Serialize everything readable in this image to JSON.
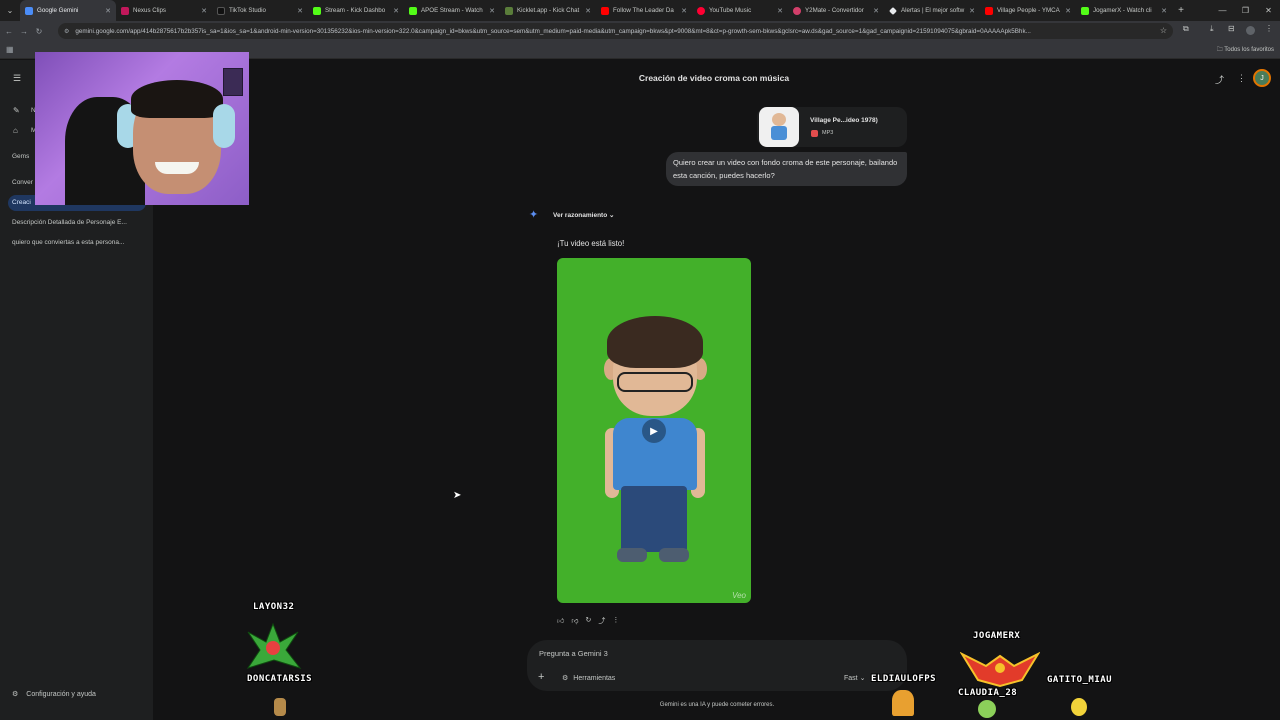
{
  "browser": {
    "tabs": [
      {
        "title": "Google Gemini",
        "color": "#4b8df8"
      },
      {
        "title": "Nexus Clips",
        "color": "#c2185b"
      },
      {
        "title": "TikTok Studio",
        "color": "#111111"
      },
      {
        "title": "Stream - Kick Dashbo",
        "color": "#53fc18"
      },
      {
        "title": "APOE Stream - Watch",
        "color": "#53fc18"
      },
      {
        "title": "Kicklet.app - Kick Chat",
        "color": "#5a7d3a"
      },
      {
        "title": "Follow The Leader Da",
        "color": "#ff0000"
      },
      {
        "title": "YouTube Music",
        "color": "#ff0033"
      },
      {
        "title": "Y2Mate - Convertidor",
        "color": "#d23f6a"
      },
      {
        "title": "Alertas | El mejor softw",
        "color": "#e8eaed"
      },
      {
        "title": "Village People - YMCA",
        "color": "#ff0000"
      },
      {
        "title": "JogamerX - Watch cli",
        "color": "#53fc18"
      }
    ],
    "url": "gemini.google.com/app/414b2875617b2b357is_sa=1&ios_sa=1&android-min-version=301356232&ios-min-version=322.0&campaign_id=bkws&utm_source=sem&utm_medium=paid-media&utm_campaign=bkws&pt=9008&mt=8&ct=p-growth-sem-bkws&gclsrc=aw.ds&gad_source=1&gad_campaignid=21591094075&gbraid=0AAAAApk5Bhk...",
    "bookmarks_label": "Todos los favoritos"
  },
  "sidebar": {
    "gems_label": "Gems",
    "items": [
      {
        "label": "N"
      },
      {
        "label": "M"
      }
    ],
    "conversations_label": "Conver",
    "chats": [
      {
        "label": "Creaci"
      },
      {
        "label": "Descripción Detallada de Personaje E..."
      },
      {
        "label": "quiero que conviertas a esta persona..."
      }
    ],
    "settings_label": "Configuración y ayuda"
  },
  "header": {
    "title": "Creación de video croma con música",
    "avatar_letter": "J"
  },
  "conversation": {
    "attachment": {
      "name": "Village Pe...ideo 1978)",
      "type": "MP3"
    },
    "user_message": "Quiero crear un video con fondo croma de este personaje, bailando esta canción, puedes hacerlo?",
    "reasoning_label": "Ver razonamiento",
    "response_text": "¡Tu video está listo!",
    "video_watermark": "Veo"
  },
  "input": {
    "placeholder": "Pregunta a Gemini 3",
    "tools_label": "Herramientas",
    "model_label": "Fast"
  },
  "disclaimer": "Gemini es una IA y puede cometer errores.",
  "overlay": {
    "names": [
      "LAYON32",
      "DONCATARSIS",
      "JOGAMERX",
      "ELDIAULOFPS",
      "CLAUDIA_28",
      "GATITO_MIAU"
    ]
  }
}
